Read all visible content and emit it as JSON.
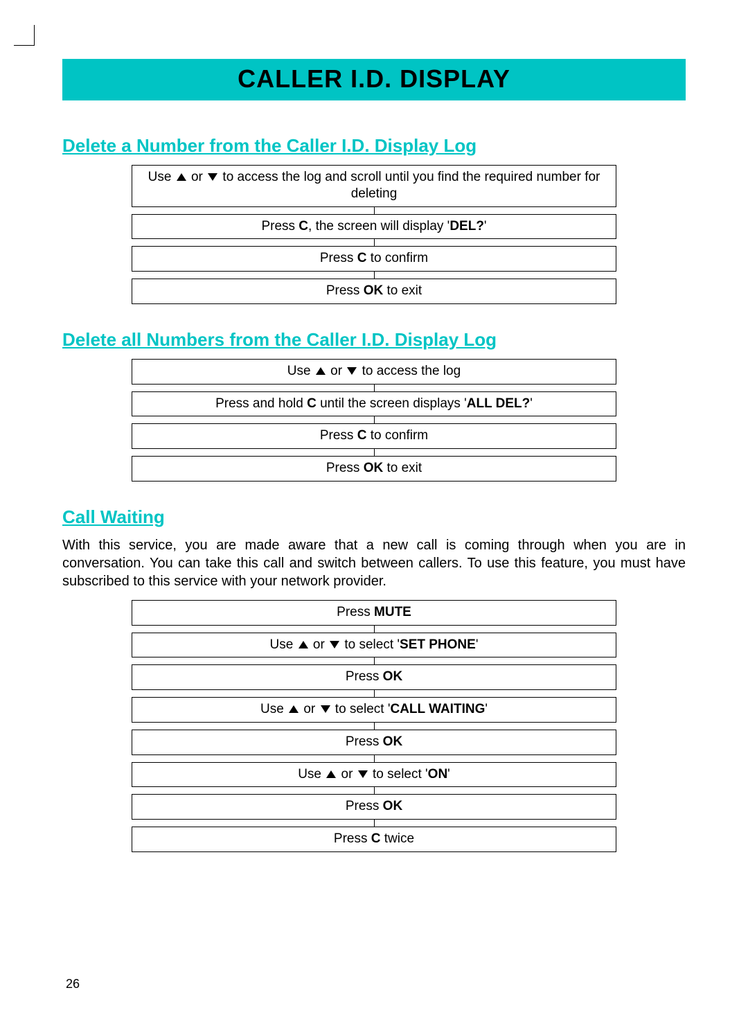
{
  "page_title": "CALLER I.D. DISPLAY",
  "page_number": "26",
  "sections": [
    {
      "heading": "Delete a Number from the Caller I.D. Display Log",
      "paragraph": "",
      "steps": [
        {
          "pre": "Use ",
          "arrows": true,
          "mid": " to access the log and scroll until you ﬁnd the required number for deleting"
        },
        {
          "pre": "Press ",
          "bold1": "C",
          "mid": ", the screen will display '",
          "bold2": "DEL?",
          "post": "'"
        },
        {
          "pre": "Press ",
          "bold1": "C",
          "mid": " to conﬁrm"
        },
        {
          "pre": "Press ",
          "bold1": "OK",
          "mid": " to exit"
        }
      ]
    },
    {
      "heading": "Delete all Numbers from the Caller I.D. Display Log",
      "paragraph": "",
      "steps": [
        {
          "pre": "Use ",
          "arrows": true,
          "mid": " to access the log"
        },
        {
          "pre": "Press and hold ",
          "bold1": "C",
          "mid": " until  the screen displays '",
          "bold2": "ALL DEL?",
          "post": "'"
        },
        {
          "pre": "Press ",
          "bold1": "C",
          "mid": " to conﬁrm"
        },
        {
          "pre": "Press ",
          "bold1": "OK",
          "mid": " to exit"
        }
      ]
    },
    {
      "heading": "Call Waiting",
      "paragraph": "With this service, you are made aware that a new call is coming through when you are in conversation. You can take this call and switch between callers. To use this feature, you must have subscribed to this service with your network provider.",
      "steps": [
        {
          "pre": "Press ",
          "bold1": "MUTE"
        },
        {
          "pre": "Use ",
          "arrows": true,
          "mid": " to select '",
          "bold2": "SET PHONE",
          "post": "'"
        },
        {
          "pre": "Press ",
          "bold1": "OK"
        },
        {
          "pre": "Use ",
          "arrows": true,
          "mid": " to select '",
          "bold2": "CALL WAITING",
          "post": "'"
        },
        {
          "pre": "Press ",
          "bold1": "OK"
        },
        {
          "pre": "Use ",
          "arrows": true,
          "mid": " to select '",
          "bold2": "ON",
          "post": "'"
        },
        {
          "pre": "Press ",
          "bold1": "OK"
        },
        {
          "pre": "Press ",
          "bold1": "C",
          "mid": " twice"
        }
      ]
    }
  ]
}
